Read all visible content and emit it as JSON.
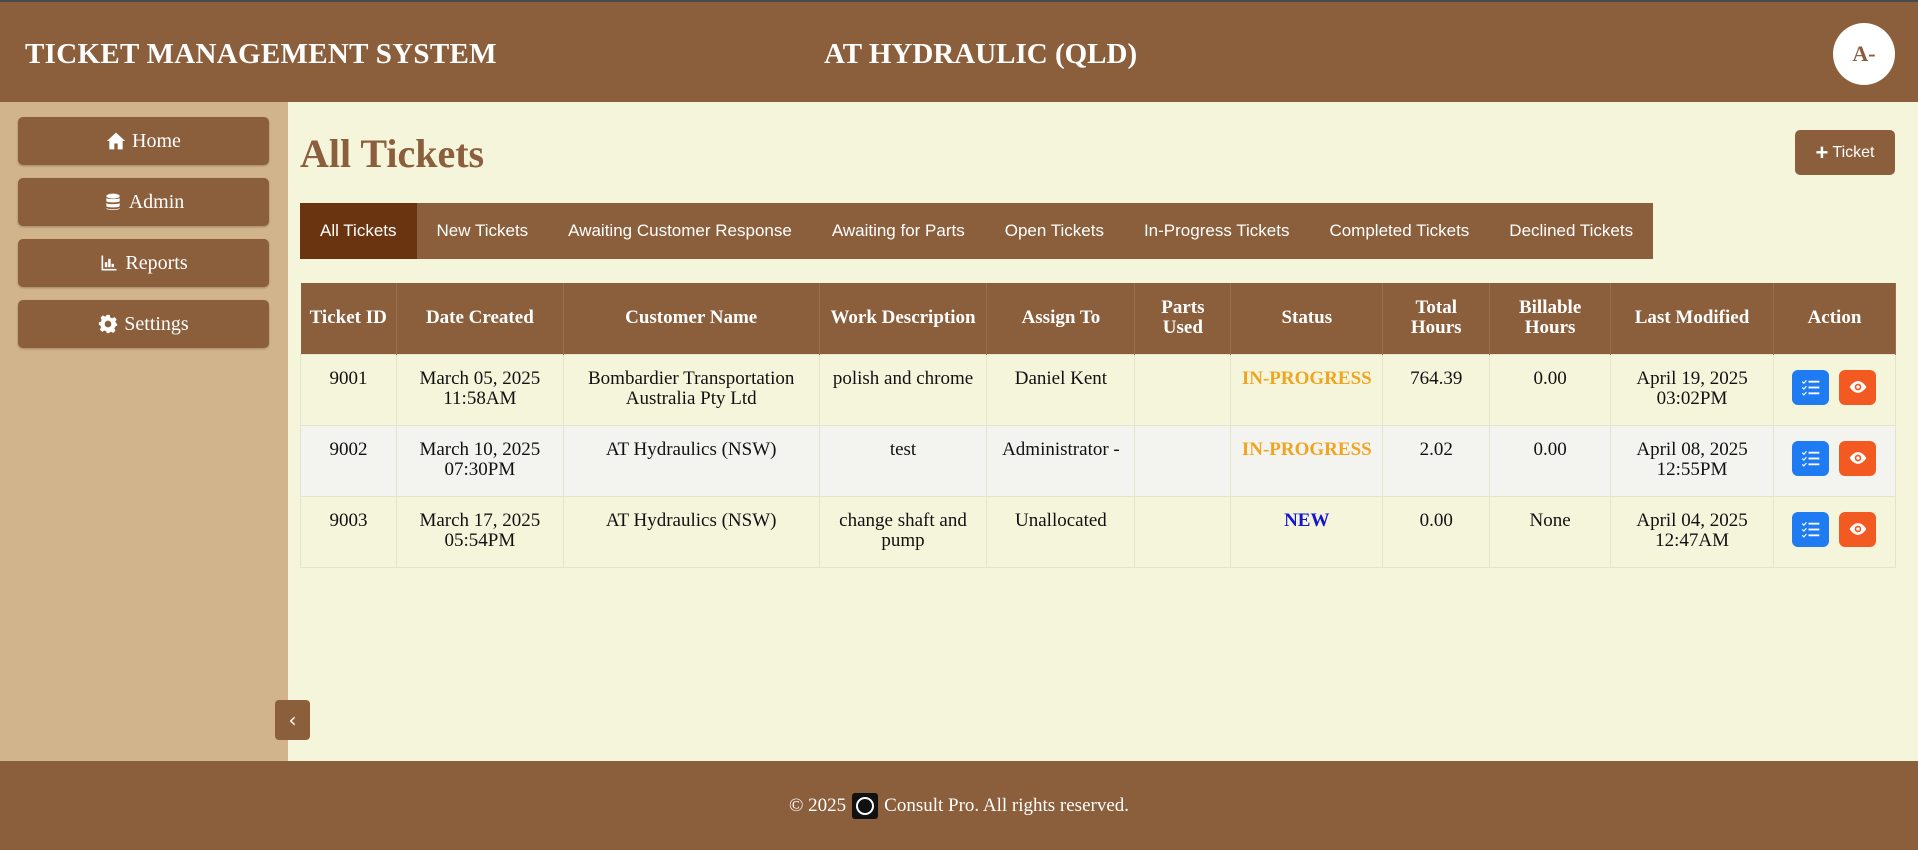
{
  "header": {
    "system_title": "TICKET MANAGEMENT SYSTEM",
    "company": "AT HYDRAULIC (QLD)",
    "avatar": "A-"
  },
  "sidebar": {
    "items": [
      {
        "label": "Home",
        "icon": "home-icon"
      },
      {
        "label": "Admin",
        "icon": "database-icon"
      },
      {
        "label": "Reports",
        "icon": "chart-icon"
      },
      {
        "label": "Settings",
        "icon": "gear-icon"
      }
    ],
    "collapse": "‹"
  },
  "main": {
    "title": "All Tickets",
    "add_button": "Ticket",
    "tabs": [
      "All Tickets",
      "New Tickets",
      "Awaiting Customer Response",
      "Awaiting for Parts",
      "Open Tickets",
      "In-Progress Tickets",
      "Completed Tickets",
      "Declined Tickets"
    ],
    "active_tab": "All Tickets"
  },
  "table": {
    "columns": [
      "Ticket ID",
      "Date Created",
      "Customer Name",
      "Work Description",
      "Assign To",
      "Parts Used",
      "Status",
      "Total Hours",
      "Billable Hours",
      "Last Modified",
      "Action"
    ],
    "rows": [
      {
        "id": "9001",
        "date": "March 05, 2025 11:58AM",
        "customer": "Bombardier Transportation Australia Pty Ltd",
        "work": "polish and chrome",
        "assign": "Daniel Kent",
        "parts": "",
        "status": "IN-PROGRESS",
        "total": "764.39",
        "billable": "0.00",
        "modified": "April 19, 2025 03:02PM"
      },
      {
        "id": "9002",
        "date": "March 10, 2025 07:30PM",
        "customer": "AT Hydraulics (NSW)",
        "work": "test",
        "assign": "Administrator -",
        "parts": "",
        "status": "IN-PROGRESS",
        "total": "2.02",
        "billable": "0.00",
        "modified": "April 08, 2025 12:55PM"
      },
      {
        "id": "9003",
        "date": "March 17, 2025 05:54PM",
        "customer": "AT Hydraulics (NSW)",
        "work": "change shaft and pump",
        "assign": "Unallocated",
        "parts": "",
        "status": "NEW",
        "total": "0.00",
        "billable": "None",
        "modified": "April 04, 2025 12:47AM"
      }
    ]
  },
  "footer": {
    "copyright": "© 2025",
    "text": "Consult Pro. All rights reserved."
  },
  "colors": {
    "brand": "#8b5e3c",
    "sidebar": "#d2b48c",
    "background": "#f5f5dc",
    "active_tab": "#6b3410",
    "in_progress": "#f0a520",
    "new": "#1515d0",
    "action_blue": "#1e7bf2",
    "action_orange": "#f25a22"
  }
}
